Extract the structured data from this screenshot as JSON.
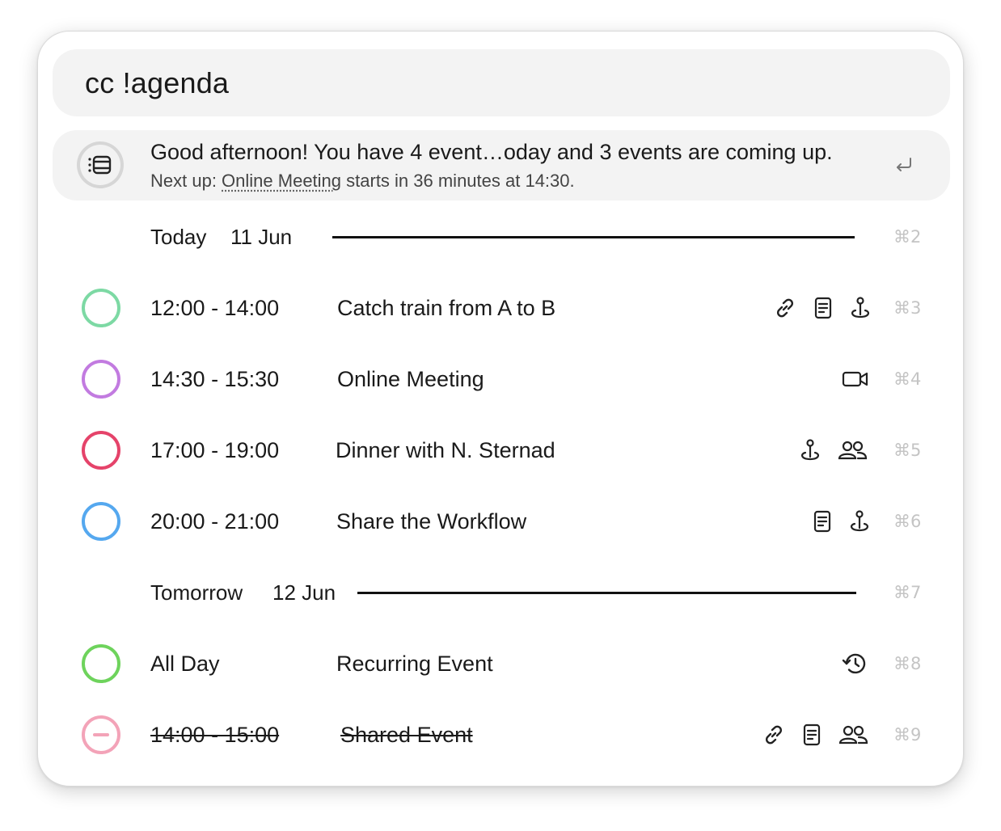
{
  "search": {
    "value": "cc !agenda"
  },
  "summary": {
    "icon": "agenda-list-icon",
    "title": "Good afternoon! You have 4 event…oday and 3 events are coming up.",
    "sub_prefix": "Next up: ",
    "sub_event": "Online Meeting",
    "sub_suffix": " starts in 36 minutes at 14:30.",
    "action_icon": "return-icon"
  },
  "sections": [
    {
      "day": "Today",
      "date": "11 Jun",
      "shortcut": "⌘2"
    },
    {
      "day": "Tomorrow",
      "date": "12 Jun",
      "shortcut": "⌘7"
    }
  ],
  "events": [
    {
      "time": "12:00 - 14:00",
      "title": "Catch train from A to B",
      "color": "#7dd9a4",
      "status": "normal",
      "icons": [
        "link-icon",
        "notes-icon",
        "location-icon"
      ],
      "shortcut": "⌘3"
    },
    {
      "time": "14:30 - 15:30",
      "title": "Online Meeting",
      "color": "#c27be0",
      "status": "normal",
      "icons": [
        "video-icon"
      ],
      "shortcut": "⌘4"
    },
    {
      "time": "17:00 - 19:00",
      "title": "Dinner with N. Sternad",
      "color": "#e5436a",
      "status": "normal",
      "icons": [
        "location-icon",
        "attendees-icon"
      ],
      "shortcut": "⌘5"
    },
    {
      "time": "20:00 - 21:00",
      "title": "Share the Workflow",
      "color": "#55a8ef",
      "status": "normal",
      "icons": [
        "notes-icon",
        "location-icon"
      ],
      "shortcut": "⌘6"
    },
    {
      "time": "All Day",
      "title": "Recurring Event",
      "color": "#6ed35c",
      "status": "normal",
      "icons": [
        "recurring-icon"
      ],
      "shortcut": "⌘8"
    },
    {
      "time": "14:00 - 15:00",
      "title": "Shared Event",
      "color": "#f3a3b8",
      "status": "declined",
      "icons": [
        "link-icon",
        "notes-icon",
        "attendees-icon"
      ],
      "shortcut": "⌘9"
    }
  ]
}
